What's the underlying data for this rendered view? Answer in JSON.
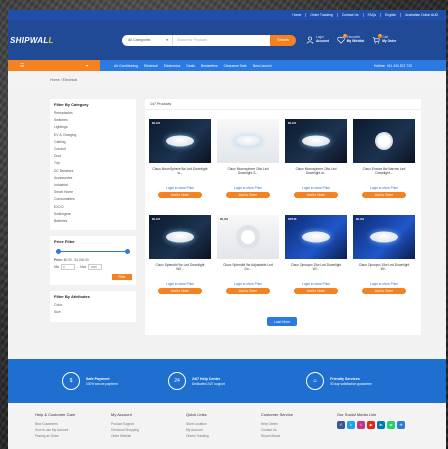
{
  "topbar": {
    "links": [
      "Home",
      "Order Tracking",
      "Contact Us",
      "FAQs",
      "English",
      "Australian Dollar AUD"
    ]
  },
  "header": {
    "logo_main": "SHIPWAL",
    "logo_accent": "L",
    "search": {
      "category": "All Categories",
      "placeholder": "Search for Products",
      "button": "Search"
    },
    "account": {
      "line1": "Login",
      "line2": "Account"
    },
    "wishlist": {
      "line1": "Favourite",
      "line2": "My Wishlist",
      "count": "0"
    },
    "cart": {
      "line1": "Cart",
      "line2": "My Order",
      "count": "0"
    }
  },
  "nav": {
    "categories_label": "☰",
    "categories_arrow": "▾",
    "menu": [
      "Air Conditioning",
      "Electrical",
      "Electronics",
      "Deals",
      "Bestsellers",
      "Clearance Sale",
      "New Launch"
    ],
    "hotline": "Hotline: +61 433 872 720"
  },
  "breadcrumb": "Home  /  Electrical",
  "sidebar": {
    "filter_category_title": "Filter By Category",
    "categories": [
      "Receptacles",
      "Switches",
      "Lightings",
      "EV & Charging",
      "Cabling",
      "Conduit",
      "Duct",
      "Trip",
      "DC Breakers",
      "Accessories",
      "Industrial",
      "Smart Home",
      "Consumables",
      "EXCO",
      "Switchgear",
      "Batteries"
    ],
    "price_filter_title": "Price Filter",
    "price_label": "Price:",
    "price_range": "$0.00 - $1,000.00",
    "min_label": "Min",
    "min_value": "0",
    "max_label": "Max",
    "max_value": "1000",
    "filter_button": "Filter",
    "attributes_title": "Filter By Attributes",
    "attributes": [
      "Color",
      "Size"
    ]
  },
  "products_section": {
    "title": "147 Products",
    "login_text": "Login to show Price",
    "button": "Add to Order",
    "items": [
      {
        "name": "Clsux MoonSphere 8w Led Downlight w...",
        "brand": "DLUX",
        "style": "dark",
        "lamp": "disc"
      },
      {
        "name": "Clsux Moonsphere 15w Led Downlight S...",
        "brand": "",
        "style": "light",
        "lamp": "disc"
      },
      {
        "name": "Clsux Moonsphere 15w Led Downlight w...",
        "brand": "DLUX",
        "style": "dark",
        "lamp": "disc"
      },
      {
        "name": "Clsux Encore 8w Narrow Led Downlight...",
        "brand": "",
        "style": "dark",
        "lamp": "sq"
      },
      {
        "name": "Clsux Splendid 9w Led Downlight W/l...",
        "brand": "DLUX",
        "style": "dark",
        "lamp": "disc"
      },
      {
        "name": "Clsux Splendid 9w Adjustable Led Do...",
        "brand": "DLUX",
        "style": "light",
        "lamp": "ring"
      },
      {
        "name": "Clsux Opsopro 15w Led Downlight W/...",
        "brand": "OPUS",
        "style": "blue",
        "lamp": "disc"
      },
      {
        "name": "Clsux Opsopro 15w Led Downlight W/...",
        "brand": "DLUX",
        "style": "blue",
        "lamp": "disc"
      }
    ],
    "load_more": "Load More"
  },
  "features": [
    {
      "icon": "$",
      "title": "Safe Payment",
      "text": "100% secure payment"
    },
    {
      "icon": "24",
      "title": "24/7 Help Center",
      "text": "Dedicated 24/7 support"
    },
    {
      "icon": "☺",
      "title": "Friendly Services",
      "text": "30 day satisfaction guarantee"
    }
  ],
  "footer": {
    "cols": [
      {
        "title": "Help & Customer Care",
        "items": [
          "New Customers",
          "How to use My Account",
          "Placing an Order"
        ]
      },
      {
        "title": "My Account",
        "items": [
          "Product Support",
          "Checkout Shopping",
          "Order Wishlist"
        ]
      },
      {
        "title": "Quick Links",
        "items": [
          "Store Location",
          "My Account",
          "Orders Tracking"
        ]
      },
      {
        "title": "Customer Service",
        "items": [
          "Help Center",
          "Contact Us",
          "Report Abuse"
        ]
      }
    ],
    "social_title": "Our Social Media Link",
    "social": [
      {
        "icon": "facebook-icon",
        "glyph": "f",
        "color": "#3b5998"
      },
      {
        "icon": "twitter-icon",
        "glyph": "t",
        "color": "#1da1f2"
      },
      {
        "icon": "instagram-icon",
        "glyph": "i",
        "color": "#c13584"
      },
      {
        "icon": "youtube-icon",
        "glyph": "▶",
        "color": "#e62117"
      },
      {
        "icon": "linkedin-icon",
        "glyph": "in",
        "color": "#0077b5"
      },
      {
        "icon": "whatsapp-icon",
        "glyph": "w",
        "color": "#25d366"
      },
      {
        "icon": "telegram-icon",
        "glyph": "✈",
        "color": "#2a7ae2"
      }
    ]
  }
}
